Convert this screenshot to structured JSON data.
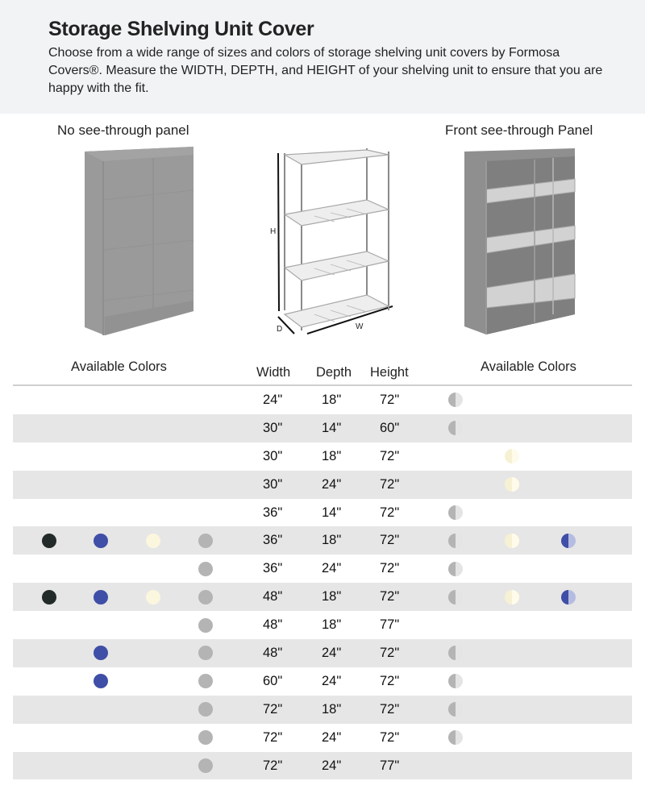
{
  "header": {
    "title": "Storage Shelving Unit Cover",
    "description": "Choose from a wide range of sizes and colors of storage shelving unit covers by Formosa Covers®. Measure the WIDTH, DEPTH, and HEIGHT of your shelving unit to ensure that you are happy with the fit."
  },
  "panels": {
    "left_label": "No see-through panel",
    "right_label": "Front see-through Panel",
    "diagram_labels": {
      "height": "H",
      "depth": "D",
      "width": "W"
    }
  },
  "table": {
    "left_colors_header": "Available Colors",
    "right_colors_header": "Available Colors",
    "columns": [
      "Width",
      "Depth",
      "Height"
    ],
    "color_swatches": {
      "black": "#232a2a",
      "blue": "#3f4ea6",
      "cream": "#fbf6de",
      "gray": "#b4b4b4",
      "gray_clear": [
        "#b4b4b4",
        "#e4e4e4"
      ],
      "cream_clear": [
        "#f7f1d4",
        "#fffbea"
      ],
      "blue_clear": [
        "#3f4ea6",
        "#b5bce2"
      ]
    },
    "rows": [
      {
        "width": "24\"",
        "depth": "18\"",
        "height": "72\"",
        "left": [],
        "right": [
          "gray_clear"
        ]
      },
      {
        "width": "30\"",
        "depth": "14\"",
        "height": "60\"",
        "left": [],
        "right": [
          "gray_clear"
        ]
      },
      {
        "width": "30\"",
        "depth": "18\"",
        "height": "72\"",
        "left": [],
        "right": [
          "cream_clear"
        ]
      },
      {
        "width": "30\"",
        "depth": "24\"",
        "height": "72\"",
        "left": [],
        "right": [
          "cream_clear"
        ]
      },
      {
        "width": "36\"",
        "depth": "14\"",
        "height": "72\"",
        "left": [],
        "right": [
          "gray_clear"
        ]
      },
      {
        "width": "36\"",
        "depth": "18\"",
        "height": "72\"",
        "left": [
          "black",
          "blue",
          "cream",
          "gray"
        ],
        "right": [
          "gray_clear",
          "cream_clear",
          "blue_clear"
        ]
      },
      {
        "width": "36\"",
        "depth": "24\"",
        "height": "72\"",
        "left": [
          "gray"
        ],
        "right": [
          "gray_clear"
        ]
      },
      {
        "width": "48\"",
        "depth": "18\"",
        "height": "72\"",
        "left": [
          "black",
          "blue",
          "cream",
          "gray"
        ],
        "right": [
          "gray_clear",
          "cream_clear",
          "blue_clear"
        ]
      },
      {
        "width": "48\"",
        "depth": "18\"",
        "height": "77\"",
        "left": [
          "gray"
        ],
        "right": []
      },
      {
        "width": "48\"",
        "depth": "24\"",
        "height": "72\"",
        "left": [
          "blue",
          "gray"
        ],
        "right": [
          "gray_clear"
        ]
      },
      {
        "width": "60\"",
        "depth": "24\"",
        "height": "72\"",
        "left": [
          "blue",
          "gray"
        ],
        "right": [
          "gray_clear"
        ]
      },
      {
        "width": "72\"",
        "depth": "18\"",
        "height": "72\"",
        "left": [
          "gray"
        ],
        "right": [
          "gray_clear"
        ]
      },
      {
        "width": "72\"",
        "depth": "24\"",
        "height": "72\"",
        "left": [
          "gray"
        ],
        "right": [
          "gray_clear"
        ]
      },
      {
        "width": "72\"",
        "depth": "24\"",
        "height": "77\"",
        "left": [
          "gray"
        ],
        "right": []
      }
    ]
  }
}
